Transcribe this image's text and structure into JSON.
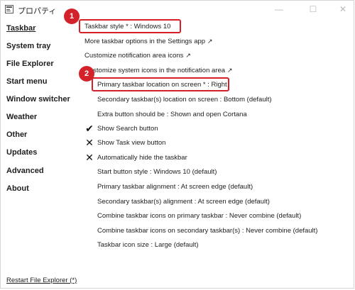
{
  "window": {
    "title": "プロパティ",
    "controls": {
      "minimize": "—",
      "maximize": "☐",
      "close": "✕"
    }
  },
  "sidebar": {
    "items": [
      {
        "label": "Taskbar",
        "active": true
      },
      {
        "label": "System tray"
      },
      {
        "label": "File Explorer"
      },
      {
        "label": "Start menu"
      },
      {
        "label": "Window switcher"
      },
      {
        "label": "Weather"
      },
      {
        "label": "Other"
      },
      {
        "label": "Updates"
      },
      {
        "label": "Advanced"
      },
      {
        "label": "About"
      }
    ],
    "footer_link": "Restart File Explorer (*)"
  },
  "options": [
    {
      "label": "Taskbar style * : Windows 10"
    },
    {
      "label": "More taskbar options in the Settings app",
      "external": "↗"
    },
    {
      "label": "Customize notification area icons",
      "external": "↗"
    },
    {
      "label": "Customize system icons in the notification area",
      "external": "↗"
    },
    {
      "label": "Primary taskbar location on screen * : Right"
    },
    {
      "label": "Secondary taskbar(s) location on screen : Bottom (default)"
    },
    {
      "label": "Extra button should be : Shown and open Cortana"
    },
    {
      "label": "Show Search button",
      "mark": "✔"
    },
    {
      "label": "Show Task view button",
      "mark": "✕"
    },
    {
      "label": "Automatically hide the taskbar",
      "mark": "✕"
    },
    {
      "label": "Start button style : Windows 10 (default)"
    },
    {
      "label": "Primary taskbar alignment : At screen edge (default)"
    },
    {
      "label": "Secondary taskbar(s) alignment : At screen edge (default)"
    },
    {
      "label": "Combine taskbar icons on primary taskbar : Never combine (default)"
    },
    {
      "label": "Combine taskbar icons on secondary taskbar(s) : Never combine (default)"
    },
    {
      "label": "Taskbar icon size : Large (default)"
    }
  ],
  "annotations": {
    "badge_1": "1",
    "badge_2": "2",
    "highlight_color": "#d61f26"
  }
}
